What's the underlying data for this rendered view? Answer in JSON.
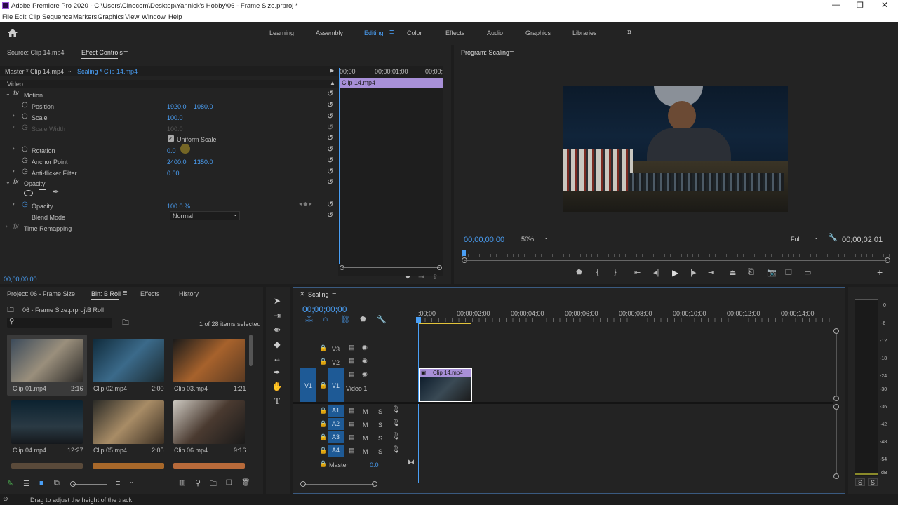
{
  "app": {
    "title": "Adobe Premiere Pro 2020 - C:\\Users\\Cinecom\\Desktop\\Yannick's Hobby\\06 - Frame Size.prproj *"
  },
  "menu": [
    "File",
    "Edit",
    "Clip",
    "Sequence",
    "Markers",
    "Graphics",
    "View",
    "Window",
    "Help"
  ],
  "workspaces": [
    "Learning",
    "Assembly",
    "Editing",
    "Color",
    "Effects",
    "Audio",
    "Graphics",
    "Libraries"
  ],
  "colors": {
    "accent": "#4a9ff5",
    "panel": "#232323",
    "clip": "#a890d8",
    "track": "#1e5a96"
  },
  "effect_controls": {
    "tab_source": "Source: Clip 14.mp4",
    "tab_active": "Effect Controls",
    "master": "Master * Clip 14.mp4",
    "sequence_clip": "Scaling * Clip 14.mp4",
    "ruler": [
      "00;00",
      "00;00;01;00",
      "00;00;"
    ],
    "clip_bar": "Clip 14.mp4",
    "video_label": "Video",
    "motion": "Motion",
    "position_label": "Position",
    "position_x": "1920.0",
    "position_y": "1080.0",
    "scale_label": "Scale",
    "scale_value": "100.0",
    "scale_width_label": "Scale Width",
    "scale_width_value": "100.0",
    "uniform_scale": "Uniform Scale",
    "rotation_label": "Rotation",
    "rotation_value": "0.0",
    "anchor_label": "Anchor Point",
    "anchor_x": "2400.0",
    "anchor_y": "1350.0",
    "antiflicker_label": "Anti-flicker Filter",
    "antiflicker_value": "0.00",
    "opacity_group": "Opacity",
    "opacity_label": "Opacity",
    "opacity_value": "100.0 %",
    "blend_label": "Blend Mode",
    "blend_value": "Normal",
    "time_remap": "Time Remapping",
    "timecode": "00;00;00;00"
  },
  "program": {
    "title": "Program: Scaling",
    "timecode": "00;00;00;00",
    "zoom": "50%",
    "quality": "Full",
    "duration": "00;00;02;01"
  },
  "project": {
    "tabs": [
      "Project: 06 - Frame Size",
      "Bin: B Roll",
      "Effects",
      "History"
    ],
    "path": "06 - Frame Size.prproj\\B Roll",
    "search_placeholder": "",
    "items_selected": "1 of 28 items selected",
    "clips": [
      {
        "name": "Clip 01.mp4",
        "duration": "2:16"
      },
      {
        "name": "Clip 02.mp4",
        "duration": "2:00"
      },
      {
        "name": "Clip 03.mp4",
        "duration": "1:21"
      },
      {
        "name": "Clip 04.mp4",
        "duration": "12:27"
      },
      {
        "name": "Clip 05.mp4",
        "duration": "2:05"
      },
      {
        "name": "Clip 06.mp4",
        "duration": "9:16"
      }
    ]
  },
  "timeline": {
    "tab": "Scaling",
    "timecode": "00;00;00;00",
    "ruler": [
      ":00;00",
      "00;00;02;00",
      "00;00;04;00",
      "00;00;06;00",
      "00;00;08;00",
      "00;00;10;00",
      "00;00;12;00",
      "00;00;14;00"
    ],
    "video_tracks": [
      "V3",
      "V2",
      "V1"
    ],
    "video1_name": "Video 1",
    "source_v1": "V1",
    "audio_tracks": [
      "A1",
      "A2",
      "A3",
      "A4"
    ],
    "m": "M",
    "s": "S",
    "master_label": "Master",
    "master_value": "0.0",
    "clip_label": "Clip 14.mp4"
  },
  "meter": {
    "ticks": [
      "0",
      "-6",
      "-12",
      "-18",
      "-24",
      "-30",
      "-36",
      "-42",
      "-48",
      "-54",
      "dB"
    ],
    "solo": [
      "S",
      "S"
    ]
  },
  "status": "Drag to adjust the height of the track."
}
